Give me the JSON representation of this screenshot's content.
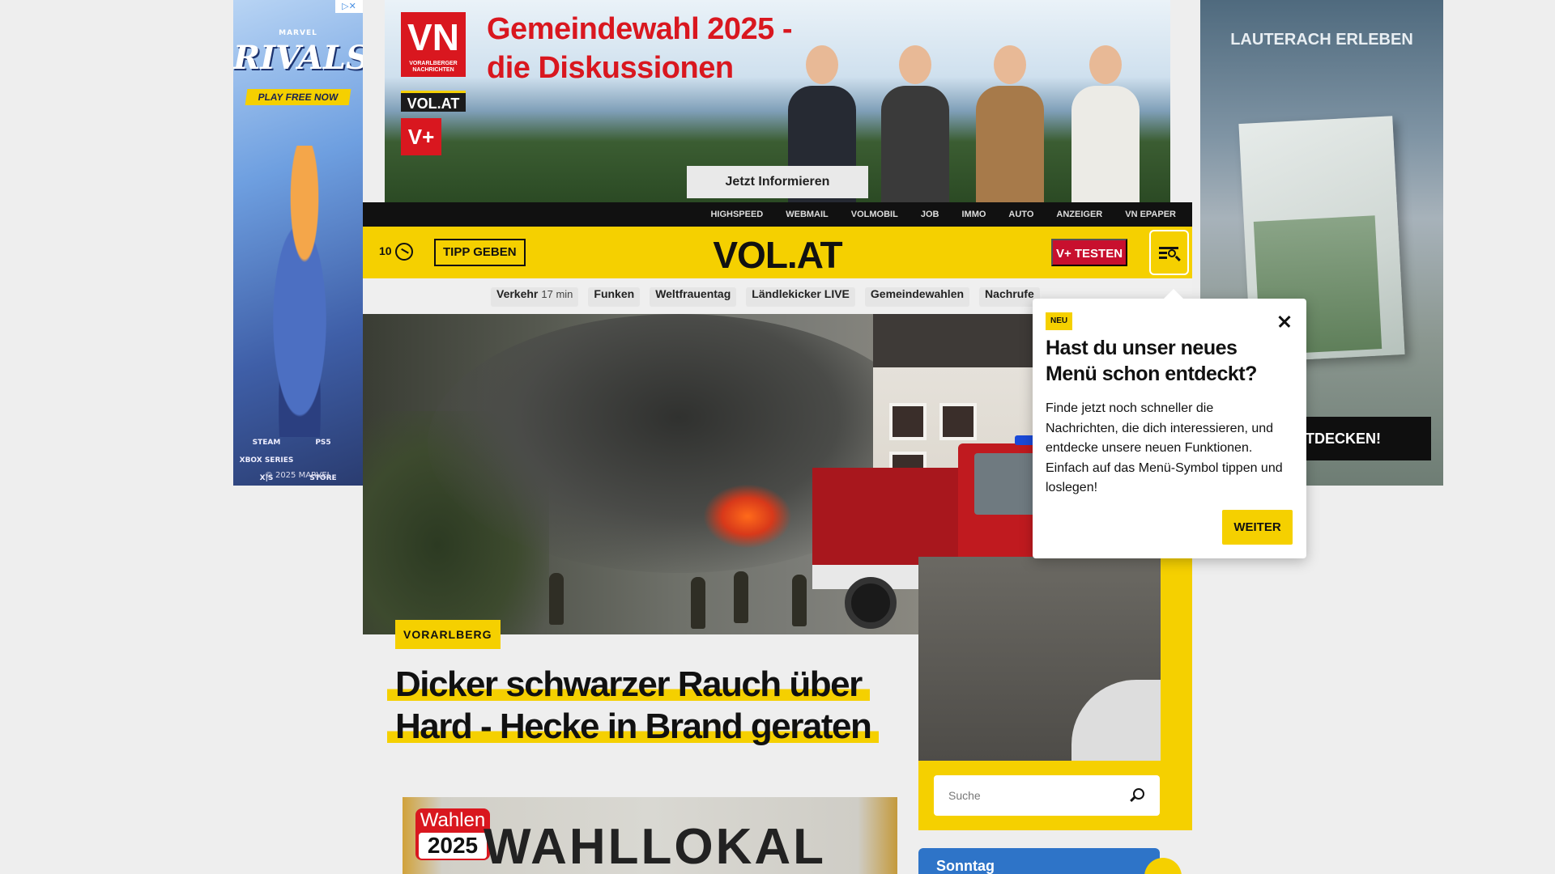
{
  "ads": {
    "left": {
      "brand": "MARVEL",
      "logo": "RIVALS",
      "cta": "PLAY FREE NOW",
      "platforms": [
        "STEAM",
        "PS5",
        "XBOX SERIES X|S",
        "STORE"
      ],
      "copyright": "© 2025 MARVEL"
    },
    "top": {
      "logo_letters": "VN",
      "logo_sub": "VORARLBERGER NACHRICHTEN",
      "volat": "VOL.AT",
      "vplus": "V+",
      "headline": "Gemeindewahl 2025 - die Diskussionen",
      "cta": "Jetzt Informieren"
    },
    "right": {
      "title": "LAUTERACH ERLEBEN",
      "cta": "ENTDECKEN!"
    }
  },
  "service_nav": [
    "HIGHSPEED",
    "WEBMAIL",
    "VOLMOBIL",
    "JOB",
    "IMMO",
    "AUTO",
    "ANZEIGER",
    "VN EPAPER"
  ],
  "header": {
    "count": "10",
    "tipp_label": "TIPP GEBEN",
    "logo": "VOL.AT",
    "vplus_label": "V+ TESTEN"
  },
  "topics": [
    {
      "label": "Verkehr",
      "meta": "17 min"
    },
    {
      "label": "Funken",
      "meta": ""
    },
    {
      "label": "Weltfrauentag",
      "meta": ""
    },
    {
      "label": "Ländlekicker LIVE",
      "meta": ""
    },
    {
      "label": "Gemeindewahlen",
      "meta": ""
    },
    {
      "label": "Nachrufe",
      "meta": ""
    }
  ],
  "article": {
    "category": "VORARLBERG",
    "headline_line1": "Dicker schwarzer Rauch über",
    "headline_line2": "Hard - Hecke in Brand geraten"
  },
  "teaser": {
    "badge_top": "Wahlen",
    "badge_year": "2025",
    "image_text": "WAHLLOKAL"
  },
  "search": {
    "placeholder": "Suche"
  },
  "sidebar_box": {
    "label": "Sonntag"
  },
  "popup": {
    "badge": "NEU",
    "title": "Hast du unser neues Menü schon entdeckt?",
    "body": "Finde jetzt noch schneller die Nachrichten, die dich interessieren, und entdecke unsere neuen Funktionen. Einfach auf das Menü-Symbol tippen und loslegen!",
    "button": "WEITER"
  },
  "colors": {
    "brand_yellow": "#f5d000",
    "vplus_red": "#c8102e",
    "dark": "#111111"
  }
}
